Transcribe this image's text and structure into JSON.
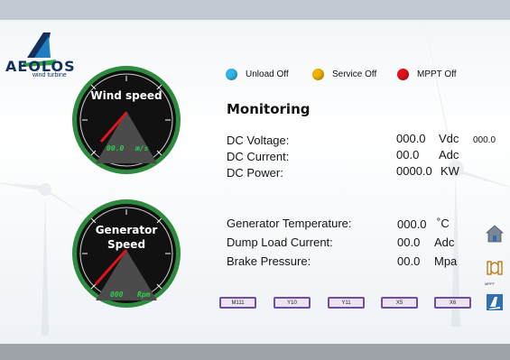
{
  "brand": {
    "name": "AEOLOS",
    "tagline": "wind turbine"
  },
  "gauges": [
    {
      "title_line1": "Wind speed",
      "title_line2": "",
      "value": "00.0",
      "unit": "m/s"
    },
    {
      "title_line1": "Generator",
      "title_line2": "Speed",
      "value": "000",
      "unit": "Rpm"
    }
  ],
  "indicators": [
    {
      "label": "Unload Off",
      "color": "#35b6e8"
    },
    {
      "label": "Service Off",
      "color": "#f0b400"
    },
    {
      "label": "MPPT Off",
      "color": "#e3101c"
    }
  ],
  "monitoring": {
    "title": "Monitoring",
    "dc_voltage": {
      "label": "DC Voltage:",
      "value": "000.0",
      "unit": "Vdc",
      "extra": "000.0"
    },
    "dc_current": {
      "label": "DC Current:",
      "value": "00.0",
      "unit": "Adc"
    },
    "dc_power": {
      "label": "DC Power:",
      "value": "0000.0",
      "unit": "KW"
    },
    "gen_temp": {
      "label": "Generator Temperature:",
      "value": "000.0",
      "unit": "˚C"
    },
    "dump_current": {
      "label": "Dump Load Current:",
      "value": "00.0",
      "unit": "Adc"
    },
    "brake_pressure": {
      "label": "Brake Pressure:",
      "value": "00.0",
      "unit": "Mpa"
    }
  },
  "buttons": [
    "M111",
    "Y10",
    "Y11",
    "X5",
    "X6"
  ],
  "side": {
    "home_icon": "home-icon",
    "mppt_icon": "mppt-icon",
    "mppt_label": "MPPT",
    "logo_icon": "aeolos-logo-icon"
  }
}
